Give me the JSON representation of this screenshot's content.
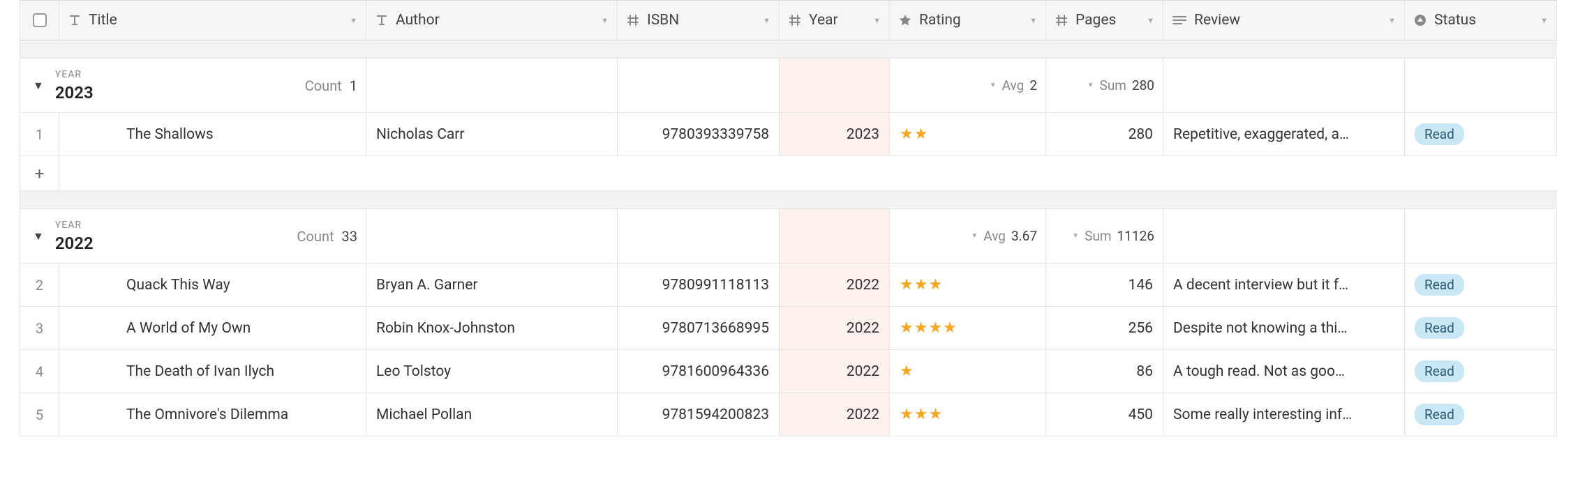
{
  "columns": {
    "title": "Title",
    "author": "Author",
    "isbn": "ISBN",
    "year": "Year",
    "rating": "Rating",
    "pages": "Pages",
    "review": "Review",
    "status": "Status"
  },
  "group_field_label": "YEAR",
  "count_label": "Count",
  "avg_label": "Avg",
  "sum_label": "Sum",
  "groups": [
    {
      "value": "2023",
      "count": "1",
      "rating_avg": "2",
      "pages_sum": "280",
      "rows": [
        {
          "idx": "1",
          "title": "The Shallows",
          "author": "Nicholas Carr",
          "isbn": "9780393339758",
          "year": "2023",
          "rating": 2,
          "pages": "280",
          "review": "Repetitive, exaggerated, a…",
          "status": "Read"
        }
      ],
      "show_add": true
    },
    {
      "value": "2022",
      "count": "33",
      "rating_avg": "3.67",
      "pages_sum": "11126",
      "rows": [
        {
          "idx": "2",
          "title": "Quack This Way",
          "author": "Bryan A. Garner",
          "isbn": "9780991118113",
          "year": "2022",
          "rating": 3,
          "pages": "146",
          "review": "A decent interview but it f…",
          "status": "Read"
        },
        {
          "idx": "3",
          "title": "A World of My Own",
          "author": "Robin Knox-Johnston",
          "isbn": "9780713668995",
          "year": "2022",
          "rating": 4,
          "pages": "256",
          "review": "Despite not knowing a thi…",
          "status": "Read"
        },
        {
          "idx": "4",
          "title": "The Death of Ivan Ilych",
          "author": "Leo Tolstoy",
          "isbn": "9781600964336",
          "year": "2022",
          "rating": 1,
          "pages": "86",
          "review": "A tough read. Not as goo…",
          "status": "Read"
        },
        {
          "idx": "5",
          "title": "The Omnivore's Dilemma",
          "author": "Michael Pollan",
          "isbn": "9781594200823",
          "year": "2022",
          "rating": 3,
          "pages": "450",
          "review": "Some really interesting inf…",
          "status": "Read"
        }
      ],
      "show_add": false
    }
  ]
}
